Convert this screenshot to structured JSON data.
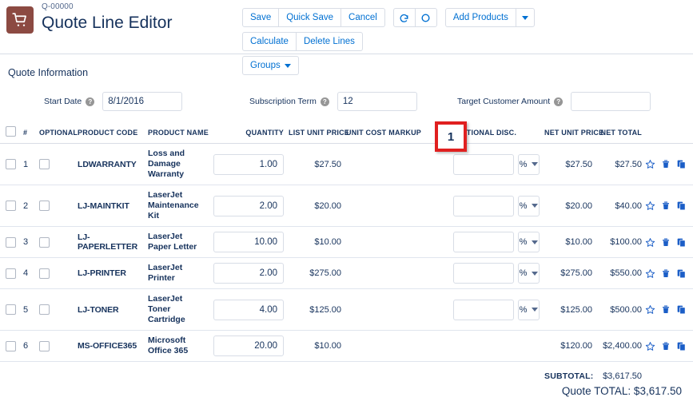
{
  "header": {
    "record_id": "Q-00000",
    "title": "Quote Line Editor",
    "app_icon": "shopping-cart-icon"
  },
  "toolbar": {
    "save_label": "Save",
    "quick_save_label": "Quick Save",
    "cancel_label": "Cancel",
    "redo_icon": "redo-icon",
    "undo_icon": "circle-icon",
    "add_products_label": "Add Products",
    "add_products_caret": "chevron-down-icon",
    "calculate_label": "Calculate",
    "delete_lines_label": "Delete Lines",
    "groups_label": "Groups",
    "groups_caret": "chevron-down-icon",
    "accent_color": "#0070d2"
  },
  "quote_info": {
    "section_title": "Quote Information",
    "fields": [
      {
        "label": "Start Date",
        "value": "8/1/2016",
        "placeholder": "",
        "help": "?"
      },
      {
        "label": "Subscription Term",
        "value": "12",
        "placeholder": "",
        "help": "?"
      },
      {
        "label": "Target Customer Amount",
        "value": "",
        "placeholder": "",
        "help": "?"
      }
    ]
  },
  "table": {
    "columns": {
      "number": "#",
      "optional": "OPTIONAL",
      "product_code": "PRODUCT CODE",
      "product_name": "PRODUCT NAME",
      "quantity": "QUANTITY",
      "list_unit_price": "LIST UNIT PRICE",
      "unit_cost": "UNIT COST",
      "markup": "MARKUP",
      "additional_disc": "ADDITIONAL DISC.",
      "net_unit_price": "NET UNIT PRICE",
      "net_total": "NET TOTAL"
    },
    "discount_unit": "%",
    "rows": [
      {
        "num": "1",
        "code": "LDWARRANTY",
        "name": "Loss and Damage Warranty",
        "qty": "1.00",
        "list_unit_price": "$27.50",
        "unit_cost": "",
        "markup": "",
        "additional_disc": "",
        "net_unit_price": "$27.50",
        "net_total": "$27.50",
        "has_discount_control": true
      },
      {
        "num": "2",
        "code": "LJ-MAINTKIT",
        "name": "LaserJet Maintenance Kit",
        "qty": "2.00",
        "list_unit_price": "$20.00",
        "unit_cost": "",
        "markup": "",
        "additional_disc": "",
        "net_unit_price": "$20.00",
        "net_total": "$40.00",
        "has_discount_control": true
      },
      {
        "num": "3",
        "code": "LJ-PAPERLETTER",
        "name": "LaserJet Paper Letter",
        "qty": "10.00",
        "list_unit_price": "$10.00",
        "unit_cost": "",
        "markup": "",
        "additional_disc": "",
        "net_unit_price": "$10.00",
        "net_total": "$100.00",
        "has_discount_control": true
      },
      {
        "num": "4",
        "code": "LJ-PRINTER",
        "name": "LaserJet Printer",
        "qty": "2.00",
        "list_unit_price": "$275.00",
        "unit_cost": "",
        "markup": "",
        "additional_disc": "",
        "net_unit_price": "$275.00",
        "net_total": "$550.00",
        "has_discount_control": true
      },
      {
        "num": "5",
        "code": "LJ-TONER",
        "name": "LaserJet Toner Cartridge",
        "qty": "4.00",
        "list_unit_price": "$125.00",
        "unit_cost": "",
        "markup": "",
        "additional_disc": "",
        "net_unit_price": "$125.00",
        "net_total": "$500.00",
        "has_discount_control": true
      },
      {
        "num": "6",
        "code": "MS-OFFICE365",
        "name": "Microsoft Office 365",
        "qty": "20.00",
        "list_unit_price": "$10.00",
        "unit_cost": "",
        "markup": "",
        "additional_disc": "",
        "net_unit_price": "$120.00",
        "net_total": "$2,400.00",
        "has_discount_control": false
      }
    ],
    "row_actions": {
      "favorite": "star-icon",
      "delete": "trash-icon",
      "duplicate": "copy-icon"
    }
  },
  "totals": {
    "subtotal_label": "SUBTOTAL:",
    "subtotal_value": "$3,617.50",
    "quote_total": "Quote TOTAL: $3,617.50"
  },
  "annotations": [
    {
      "id": "1",
      "label": "1",
      "color": "#e02020"
    }
  ]
}
